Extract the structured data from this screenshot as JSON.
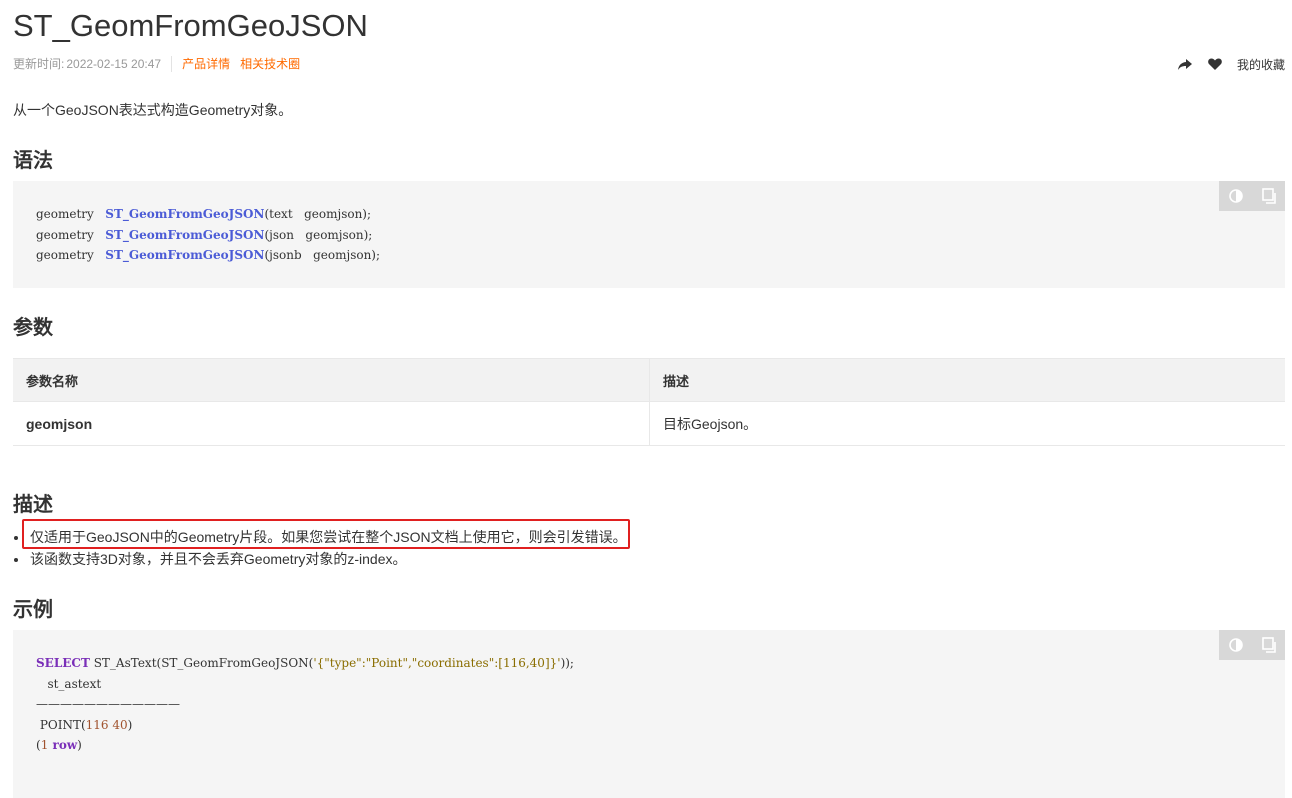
{
  "page": {
    "title": "ST_GeomFromGeoJSON",
    "updated_label": "更新时间:",
    "updated_date": "2022-02-15 20:47",
    "links": [
      "产品详情",
      "相关技术圈"
    ],
    "favorite_label": "我的收藏",
    "intro": "从一个GeoJSON表达式构造Geometry对象。"
  },
  "syntax": {
    "heading": "语法",
    "lines": [
      {
        "ret": "geometry",
        "fn": "ST_GeomFromGeoJSON",
        "args": "(text   geomjson);"
      },
      {
        "ret": "geometry",
        "fn": "ST_GeomFromGeoJSON",
        "args": "(json   geomjson);"
      },
      {
        "ret": "geometry",
        "fn": "ST_GeomFromGeoJSON",
        "args": "(jsonb   geomjson);"
      }
    ]
  },
  "params": {
    "heading": "参数",
    "columns": [
      "参数名称",
      "描述"
    ],
    "rows": [
      {
        "name": "geomjson",
        "desc": "目标Geojson。"
      }
    ]
  },
  "description": {
    "heading": "描述",
    "items": [
      "仅适用于GeoJSON中的Geometry片段。如果您尝试在整个JSON文档上使用它，则会引发错误。",
      "该函数支持3D对象，并且不会丢弃Geometry对象的z-index。"
    ]
  },
  "example": {
    "heading": "示例",
    "keyword": "SELECT",
    "query_rest": " ST_AsText(ST_GeomFromGeoJSON(",
    "query_string": "'{\"type\":\"Point\",\"coordinates\":[116,40]}'",
    "query_end": "));",
    "column_header": "   st_astext",
    "separator": "————————————",
    "result_prefix": " POINT(",
    "result_value": "116 40",
    "result_suffix": ")",
    "rows_open": "(",
    "rows_count": "1",
    "rows_word": " row",
    "rows_close": ")"
  },
  "colors": {
    "link": "#ff6a00",
    "function": "#4b5bd6",
    "keyword": "#7a2fb8",
    "highlight_border": "#e02020",
    "code_background": "#f5f5f5"
  }
}
